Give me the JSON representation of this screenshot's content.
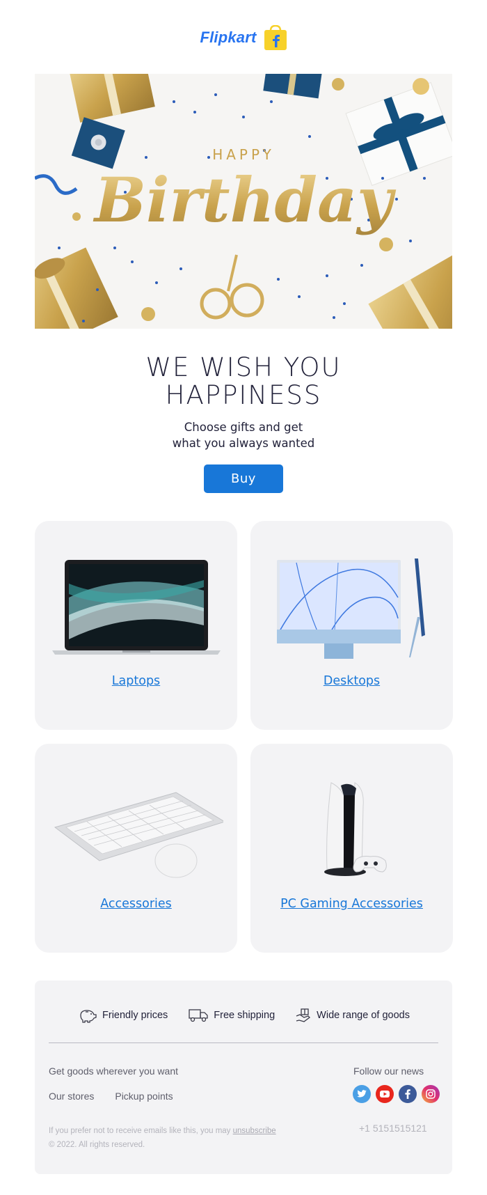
{
  "header": {
    "brand": "Flipkart",
    "logo_icon": "flipkart-bag-logo",
    "brand_color": "#2874f0",
    "bag_color": "#f7d12a"
  },
  "hero": {
    "small_text": "HAPPY",
    "script_text": "Birthday",
    "gold_color": "#c9a24c",
    "blue_color": "#1b4f7c"
  },
  "main": {
    "headline_line1": "WE WISH YOU",
    "headline_line2": "HAPPINESS",
    "sub_line1": "Choose gifts and get",
    "sub_line2": "what you always wanted",
    "buy_label": "Buy",
    "accent_color": "#1877d8"
  },
  "categories": [
    {
      "label": "Laptops",
      "icon": "laptop-image"
    },
    {
      "label": "Desktops",
      "icon": "desktop-image"
    },
    {
      "label": "Accessories",
      "icon": "keyboard-mouse-image"
    },
    {
      "label": "PC Gaming Accessories",
      "icon": "game-console-image"
    }
  ],
  "footer": {
    "features": [
      {
        "label": "Friendly prices",
        "icon": "piggy-bank-icon"
      },
      {
        "label": "Free shipping",
        "icon": "truck-icon"
      },
      {
        "label": "Wide range of goods",
        "icon": "hand-gift-icon"
      }
    ],
    "left_title": "Get goods wherever you want",
    "links": [
      "Our stores",
      "Pickup points"
    ],
    "right_title": "Follow our news",
    "socials": [
      {
        "name": "twitter",
        "icon": "twitter-icon",
        "color": "#4a9fe5"
      },
      {
        "name": "youtube",
        "icon": "youtube-icon",
        "color": "#e8261d"
      },
      {
        "name": "facebook",
        "icon": "facebook-icon",
        "color": "#3c5a99"
      },
      {
        "name": "instagram",
        "icon": "instagram-icon",
        "color": "#d6306e"
      }
    ],
    "legal_text": "If you prefer not to receive emails like this, you may",
    "unsubscribe_label": "unsubscribe",
    "copyright": "© 2022. All rights reserved.",
    "phone": "+1 5151515121"
  }
}
